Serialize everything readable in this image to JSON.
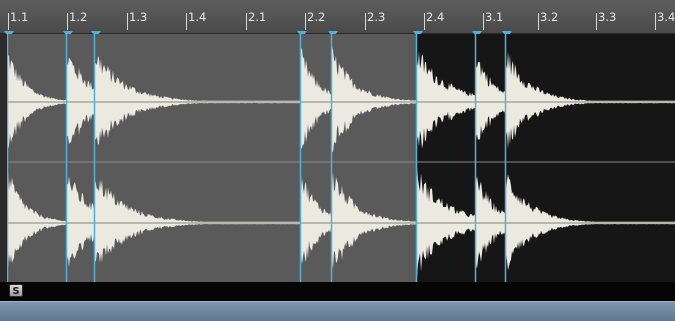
{
  "ruler": {
    "ticks": [
      "1.1",
      "1.2",
      "1.3",
      "1.4",
      "2.1",
      "2.2",
      "2.3",
      "2.4",
      "3.1",
      "3.2",
      "3.3",
      "3.4"
    ]
  },
  "solo_button": {
    "label": "S"
  },
  "colors": {
    "waveform": "#ece9e0",
    "selected_region": "#5a5a5a",
    "unselected_region": "#161616",
    "slice_marker": "#4fb1d8",
    "footer": "#6f87a0"
  },
  "slices": [
    {
      "start_beat": "1.1",
      "selected": true
    },
    {
      "start_beat": "1.2",
      "selected": true
    },
    {
      "start_beat": "1.2",
      "selected": true
    },
    {
      "start_beat": "2.2",
      "selected": true
    },
    {
      "start_beat": "2.2",
      "selected": true
    },
    {
      "start_beat": "2.4",
      "selected": false
    },
    {
      "start_beat": "3.1",
      "selected": false
    },
    {
      "start_beat": "3.1",
      "selected": false
    }
  ]
}
